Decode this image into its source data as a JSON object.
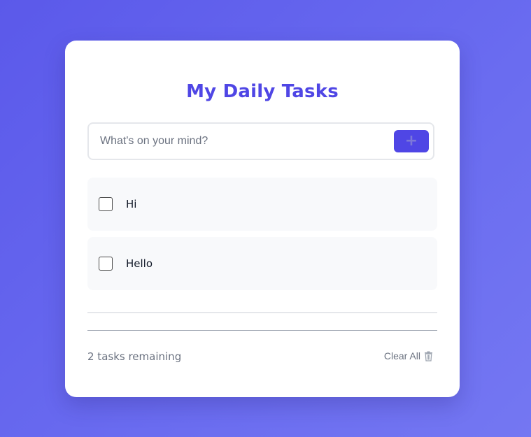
{
  "app": {
    "title": "My Daily Tasks"
  },
  "input": {
    "placeholder": "What's on your mind?",
    "value": "",
    "add_label": "+"
  },
  "tasks": [
    {
      "label": "Hi",
      "done": false
    },
    {
      "label": "Hello",
      "done": false
    }
  ],
  "footer": {
    "remaining_text": "2 tasks remaining",
    "clear_label": "Clear All",
    "clear_icon": "trash-icon"
  },
  "colors": {
    "accent": "#4f46e5",
    "background_start": "#5b59ea",
    "background_end": "#7477f2"
  }
}
